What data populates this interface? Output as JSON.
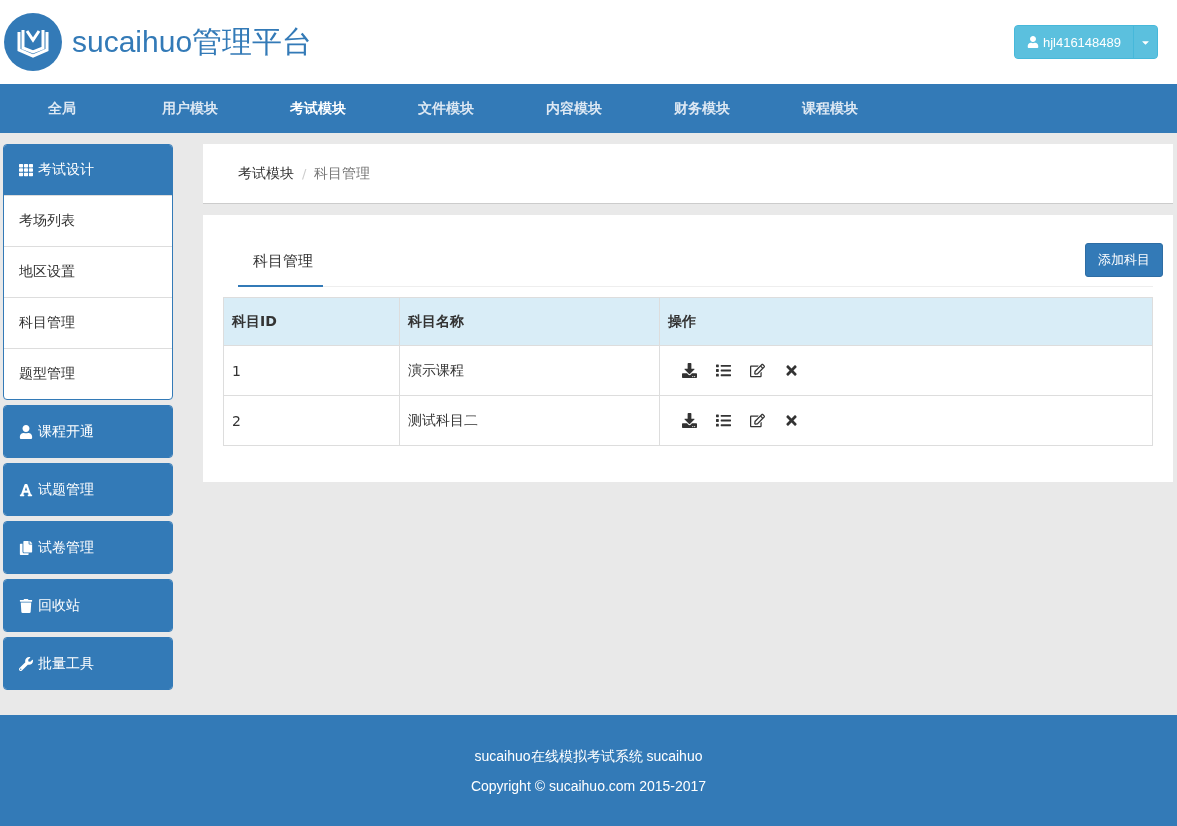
{
  "header": {
    "brand": "sucaihuo管理平台",
    "user": {
      "name": "hjl416148489"
    }
  },
  "nav": [
    {
      "label": "全局",
      "selected": false
    },
    {
      "label": "用户模块",
      "selected": false
    },
    {
      "label": "考试模块",
      "selected": true
    },
    {
      "label": "文件模块",
      "selected": false
    },
    {
      "label": "内容模块",
      "selected": false
    },
    {
      "label": "财务模块",
      "selected": false
    },
    {
      "label": "课程模块",
      "selected": false
    }
  ],
  "sidebar": [
    {
      "label": "考试设计",
      "kind": "grid",
      "expanded": true,
      "children": [
        {
          "label": "考场列表"
        },
        {
          "label": "地区设置"
        },
        {
          "label": "科目管理"
        },
        {
          "label": "题型管理"
        }
      ]
    },
    {
      "label": "课程开通",
      "kind": "user",
      "expanded": false
    },
    {
      "label": "试题管理",
      "kind": "font",
      "expanded": false
    },
    {
      "label": "试卷管理",
      "kind": "copy",
      "expanded": false
    },
    {
      "label": "回收站",
      "kind": "trash",
      "expanded": false
    },
    {
      "label": "批量工具",
      "kind": "wrench",
      "expanded": false
    }
  ],
  "breadcrumb": {
    "separator": "/",
    "items": [
      "考试模块",
      "科目管理"
    ]
  },
  "tabs": [
    {
      "label": "科目管理",
      "selected": true
    }
  ],
  "add_button": "添加科目",
  "table": {
    "columns": [
      "科目ID",
      "科目名称",
      "操作"
    ],
    "rows": [
      {
        "id": "1",
        "name": "演示课程",
        "actions": [
          {
            "kind": "download"
          },
          {
            "kind": "list"
          },
          {
            "kind": "edit"
          },
          {
            "kind": "delete"
          }
        ]
      },
      {
        "id": "2",
        "name": "测试科目二",
        "actions": [
          {
            "kind": "download"
          },
          {
            "kind": "list"
          },
          {
            "kind": "edit"
          },
          {
            "kind": "delete"
          }
        ]
      }
    ]
  },
  "footer": [
    "sucaihuo在线模拟考试系统 sucaihuo",
    "Copyright © sucaihuo.com 2015-2017"
  ]
}
